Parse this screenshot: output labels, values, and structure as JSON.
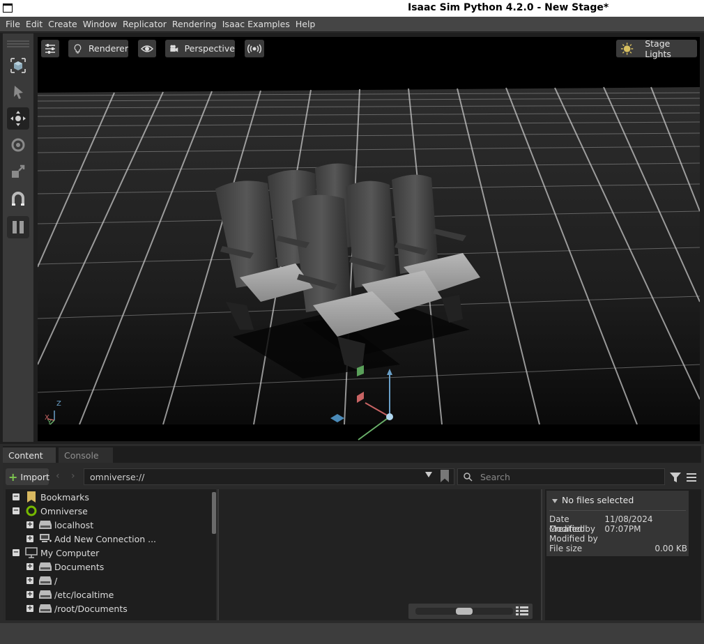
{
  "window": {
    "title": "Isaac Sim Python 4.2.0 - New Stage*"
  },
  "menu": [
    "File",
    "Edit",
    "Create",
    "Window",
    "Replicator",
    "Rendering",
    "Isaac Examples",
    "Help"
  ],
  "viewport": {
    "renderer_label": "Renderer",
    "camera_label": "Perspective",
    "lights_label": "Stage Lights",
    "axis_labels": {
      "z": "Z",
      "x": "X",
      "y": "Y"
    }
  },
  "toolbar": {
    "tools": [
      "select-mode-icon",
      "select-icon",
      "move-icon",
      "rotate-icon",
      "scale-icon",
      "snap-icon",
      "pause-icon"
    ]
  },
  "bottom_panel": {
    "tabs": [
      "Content",
      "Console"
    ],
    "active_tab": "Content",
    "import_label": "Import",
    "path_value": "omniverse://",
    "search_placeholder": "Search",
    "tree": [
      {
        "label": "Bookmarks",
        "level": 0,
        "expander": "−",
        "icon": "bookmark-icon"
      },
      {
        "label": "Omniverse",
        "level": 0,
        "expander": "−",
        "icon": "omniverse-icon"
      },
      {
        "label": "localhost",
        "level": 1,
        "expander": "+",
        "icon": "drive-icon"
      },
      {
        "label": "Add New Connection ...",
        "level": 1,
        "expander": "+",
        "icon": "add-connection-icon"
      },
      {
        "label": "My Computer",
        "level": 0,
        "expander": "−",
        "icon": "computer-icon"
      },
      {
        "label": "Documents",
        "level": 1,
        "expander": "+",
        "icon": "drive-icon"
      },
      {
        "label": "/",
        "level": 1,
        "expander": "+",
        "icon": "drive-icon"
      },
      {
        "label": "/etc/localtime",
        "level": 1,
        "expander": "+",
        "icon": "drive-icon"
      },
      {
        "label": "/root/Documents",
        "level": 1,
        "expander": "+",
        "icon": "drive-icon"
      }
    ],
    "details": {
      "header": "No files selected",
      "date_modified_label": "Date Modified",
      "date_modified_value": "11/08/2024 07:07PM",
      "created_by_label": "Created by",
      "modified_by_label": "Modified by",
      "file_size_label": "File size",
      "file_size_value": "0.00 KB"
    }
  }
}
